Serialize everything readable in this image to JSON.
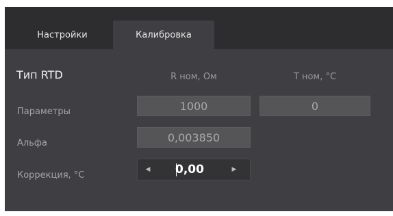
{
  "tabs": [
    {
      "label": "Настройки"
    },
    {
      "label": "Калибровка"
    }
  ],
  "rtd": {
    "title": "Тип RTD",
    "col_r": "R ном, Ом",
    "col_t": "T ном, °C",
    "params_label": "Параметры",
    "r_nom": "1000",
    "t_nom": "0",
    "alpha_label": "Альфа",
    "alpha": "0,003850",
    "corr_label": "Коррекция, °C",
    "corr": "0,00"
  },
  "icons": {
    "left": "left-arrow-icon",
    "right": "right-arrow-icon"
  }
}
